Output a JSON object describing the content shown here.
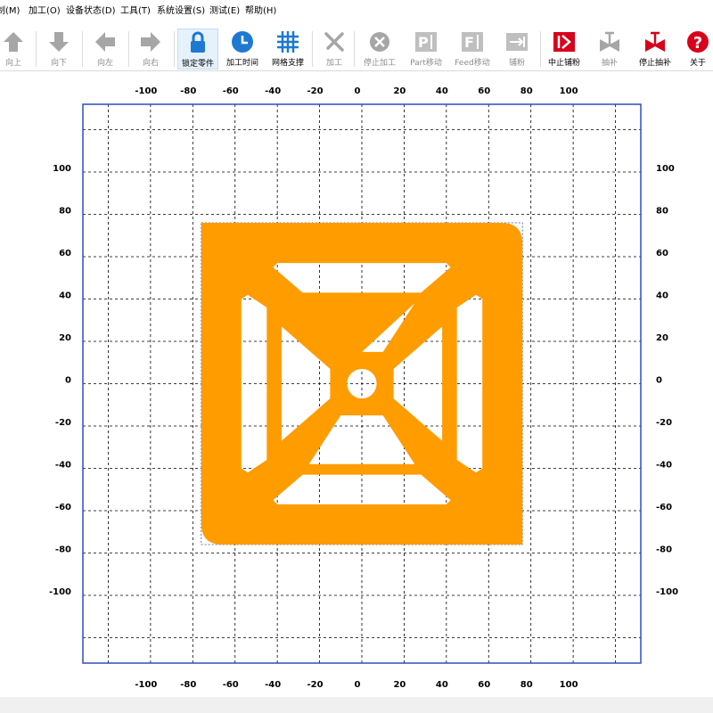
{
  "menu": [
    "制(M)",
    "加工(O)",
    "设备状态(D)",
    "工具(T)",
    "系统设置(S)",
    "测试(E)",
    "帮助(H)"
  ],
  "toolbar": [
    {
      "label": "向上",
      "icon": "arrow-up-icon",
      "enabled": false
    },
    {
      "label": "向下",
      "icon": "arrow-down-icon",
      "enabled": false
    },
    {
      "label": "向左",
      "icon": "arrow-left-icon",
      "enabled": false
    },
    {
      "label": "向右",
      "icon": "arrow-right-icon",
      "enabled": false
    },
    {
      "label": "锁定零件",
      "icon": "lock-icon",
      "enabled": true,
      "pressed": true
    },
    {
      "label": "加工时间",
      "icon": "clock-icon",
      "enabled": true
    },
    {
      "label": "网格支撑",
      "icon": "grid-icon",
      "enabled": true
    },
    {
      "label": "加工",
      "icon": "tools-icon",
      "enabled": false
    },
    {
      "label": "停止加工",
      "icon": "stop-circle-icon",
      "enabled": false
    },
    {
      "label": "Part移动",
      "icon": "part-move-icon",
      "enabled": false
    },
    {
      "label": "Feed移动",
      "icon": "feed-move-icon",
      "enabled": false
    },
    {
      "label": "铺粉",
      "icon": "spread-powder-icon",
      "enabled": false
    },
    {
      "label": "中止铺粉",
      "icon": "abort-spread-icon",
      "enabled": true
    },
    {
      "label": "抽补",
      "icon": "valve-icon",
      "enabled": false
    },
    {
      "label": "停止抽补",
      "icon": "valve-red-icon",
      "enabled": true
    },
    {
      "label": "关于",
      "icon": "help-icon",
      "enabled": true
    }
  ],
  "plot": {
    "x_range": [
      -132,
      132
    ],
    "y_range": [
      -132,
      132
    ],
    "grid_step": 20,
    "x_ticks": [
      -100,
      -80,
      -60,
      -40,
      -20,
      0,
      20,
      40,
      60,
      80,
      100
    ],
    "y_ticks": [
      100,
      80,
      60,
      40,
      20,
      0,
      -20,
      -40,
      -60,
      -80,
      -100
    ],
    "frame_color": "#2b4fbf",
    "part_color": "#ff9c00",
    "part_outline": [
      [
        -76,
        76
      ],
      [
        76,
        76
      ],
      [
        76,
        -76
      ],
      [
        -76,
        -76
      ]
    ],
    "part_corner_radius": 10,
    "hole_radius": 7
  }
}
